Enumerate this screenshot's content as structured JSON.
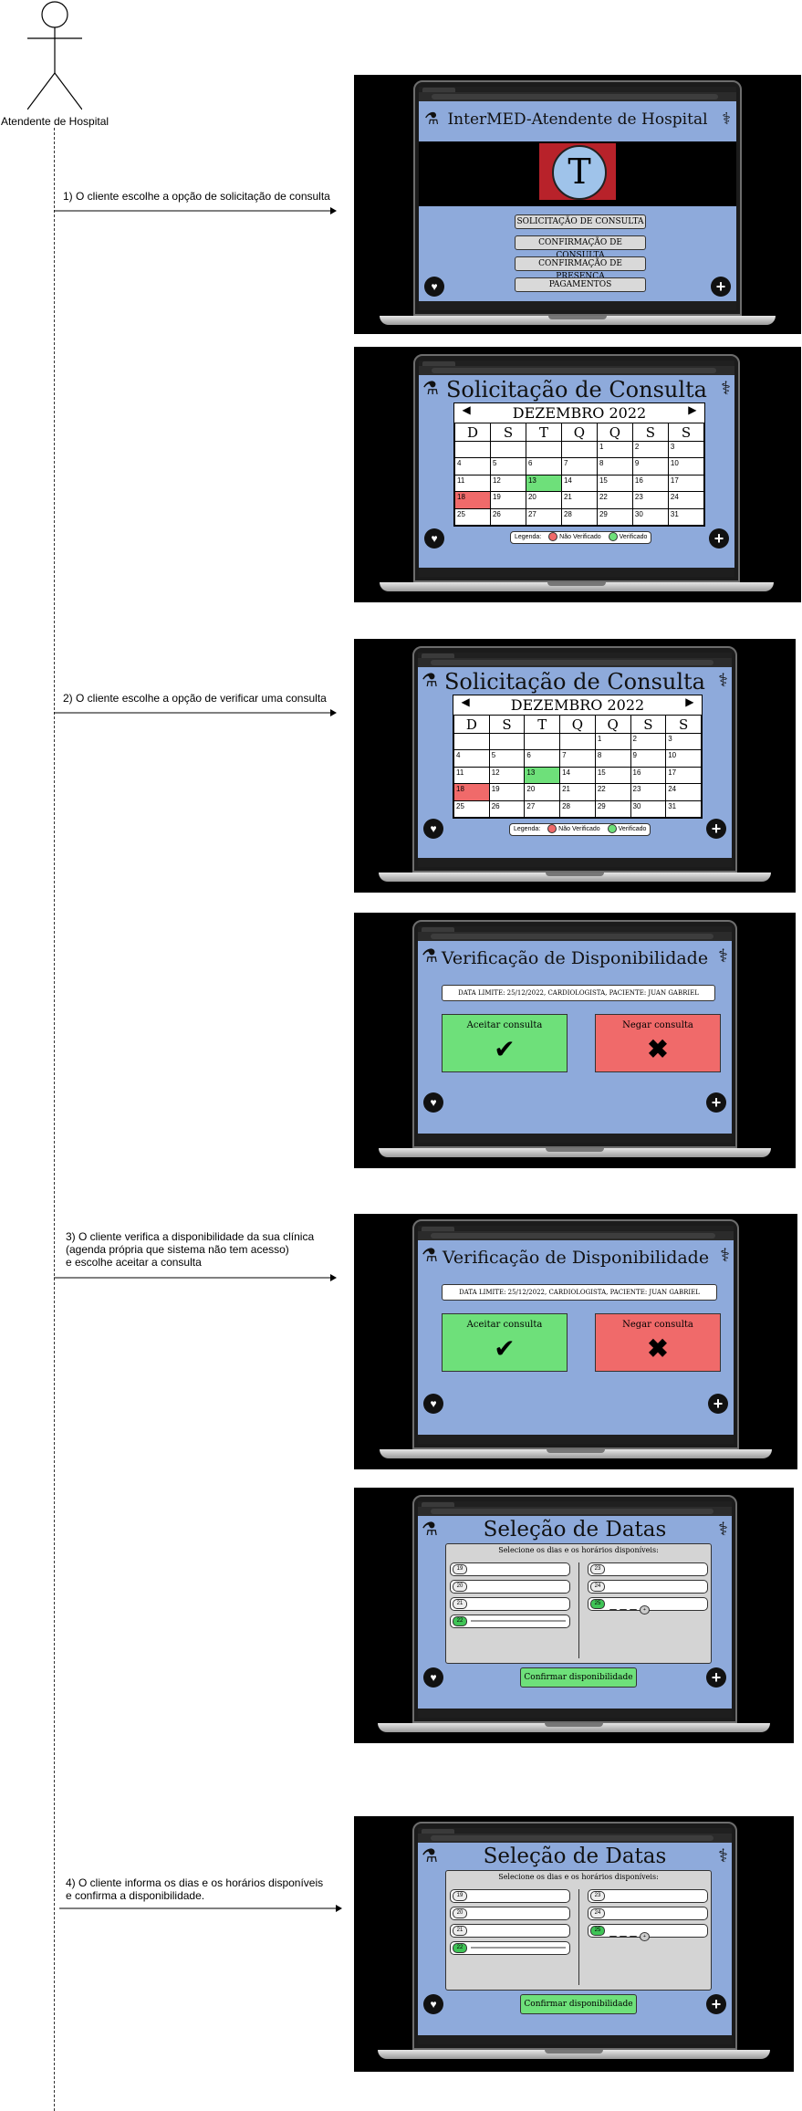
{
  "actor": {
    "name": "Atendente de Hospital"
  },
  "steps": [
    {
      "text": "1) O cliente escolhe a opção de solicitação de consulta"
    },
    {
      "text": "2) O cliente escolhe a opção de verificar uma consulta"
    },
    {
      "text": "3) O cliente verifica a disponibilidade da sua clínica\n(agenda própria que  sistema não tem acesso)\n e  escolhe aceitar a consulta"
    },
    {
      "text": "4) O cliente informa os dias e os horários disponíveis\ne confirma a disponibilidade."
    }
  ],
  "screens": {
    "home": {
      "title": "InterMED-Atendente de Hospital",
      "logo_letter": "T",
      "menu": [
        "SOLICITAÇÃO DE CONSULTA",
        "CONFIRMAÇÃO DE CONSULTA",
        "CONFIRMAÇÃO DE PRESENÇA",
        "PAGAMENTOS"
      ]
    },
    "solicitacao": {
      "title": "Solicitação de Consulta",
      "month": "DEZEMBRO 2022",
      "weekdays": [
        "D",
        "S",
        "T",
        "Q",
        "Q",
        "S",
        "S"
      ],
      "weeks": [
        [
          "",
          "",
          "",
          "",
          "1",
          "2",
          "3"
        ],
        [
          "4",
          "5",
          "6",
          "7",
          "8",
          "9",
          "10"
        ],
        [
          "11",
          "12",
          "13",
          "14",
          "15",
          "16",
          "17"
        ],
        [
          "18",
          "19",
          "20",
          "21",
          "22",
          "23",
          "24"
        ],
        [
          "25",
          "26",
          "27",
          "28",
          "29",
          "30",
          "31"
        ]
      ],
      "legend_label": "Legenda:",
      "legend_red": "Não Verificado",
      "legend_green": "Verificado"
    },
    "verificacao": {
      "title": "Verificação de Disponibilidade",
      "info": "DATA LIMITE: 25/12/2022, CARDIOLOGISTA, PACIENTE: JUAN GABRIEL",
      "accept": "Aceitar consulta",
      "deny": "Negar consulta"
    },
    "selecao": {
      "title": "Seleção de Datas",
      "subtitle": "Selecione os dias e os horários disponíveis:",
      "left_days": [
        "19",
        "20",
        "21",
        "22"
      ],
      "right_days": [
        "23",
        "24",
        "25"
      ],
      "confirm": "Confirmar disponibilidade"
    }
  },
  "colors": {
    "screen_bg": "#8eaadb",
    "accept_green": "#6ee07a",
    "deny_red": "#f06a6a",
    "frame_black": "#000000"
  }
}
